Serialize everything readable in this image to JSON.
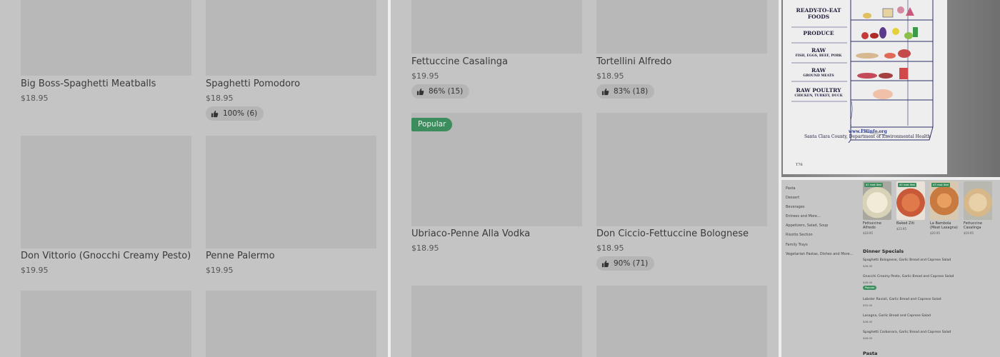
{
  "left_panel": {
    "items": [
      {
        "name": "Big Boss-Spaghetti Meatballs",
        "price": "$18.95"
      },
      {
        "name": "Spaghetti Pomodoro",
        "price": "$18.95",
        "rating": "100% (6)"
      },
      {
        "name": "Don Vittorio (Gnocchi Creamy Pesto)",
        "price": "$19.95"
      },
      {
        "name": "Penne Palermo",
        "price": "$19.95"
      }
    ]
  },
  "mid_panel": {
    "items": [
      {
        "name": "Fettuccine Casalinga",
        "price": "$19.95",
        "rating": "86% (15)"
      },
      {
        "name": "Tortellini Alfredo",
        "price": "$18.95",
        "rating": "83% (18)"
      },
      {
        "name": "Ubriaco-Penne Alla Vodka",
        "price": "$18.95",
        "badge": "Popular"
      },
      {
        "name": "Don Ciccio-Fettuccine Bolognese",
        "price": "$18.95",
        "rating": "90% (71)"
      }
    ]
  },
  "storage_chart": {
    "labels": [
      {
        "main": "READY-TO-EAT",
        "main2": "FOODS"
      },
      {
        "main": "PRODUCE"
      },
      {
        "main": "RAW",
        "sub": "FISH, EGGS, BEEF, PORK"
      },
      {
        "main": "RAW",
        "sub": "GROUND MEATS"
      },
      {
        "main": "RAW POULTRY",
        "sub": "CHICKEN, TURKEY, DUCK"
      }
    ],
    "url": "www.EHinfo.org",
    "agency": "Santa Clara County, Department of Environmental Health",
    "code": "T76"
  },
  "menu_screenshot": {
    "categories": [
      "Pasta",
      "Dessert",
      "Beverages",
      "Entrees and More...",
      "Appetizers, Salad, Soup",
      "Risotto Section",
      "Family Trays",
      "Vegetarian Pastas, Dishes and More..."
    ],
    "cards": [
      {
        "tag": "#1 most liked",
        "name": "Fettuccine Alfredo",
        "price": "$18.95"
      },
      {
        "tag": "#2 most liked",
        "name": "Baked Ziti",
        "price": "$23.95"
      },
      {
        "tag": "#3 most liked",
        "name": "La Bambola (Meat Lasagna)",
        "price": "$20.95"
      },
      {
        "tag": "",
        "name": "Fettuccine Casalinga",
        "price": "$19.95"
      }
    ],
    "specials_title": "Dinner Specials",
    "specials": [
      {
        "name": "Spaghetti Bolognese, Garlic Bread and Caprese Salad",
        "price": "$46.00"
      },
      {
        "name": "Gnocchi Creamy Pesto, Garlic Bread and Caprese Salad",
        "price": "$46.00",
        "badge": "Popular"
      },
      {
        "name": "Lobster Ravioli, Garlic Bread and Caprese Salad",
        "price": "$50.00"
      },
      {
        "name": "Lasagna, Garlic Bread and Caprese Salad",
        "price": "$46.00"
      },
      {
        "name": "Spaghetti Carbonara, Garlic Bread and Caprese Salad",
        "price": "$46.00"
      }
    ],
    "pasta_title": "Pasta"
  }
}
